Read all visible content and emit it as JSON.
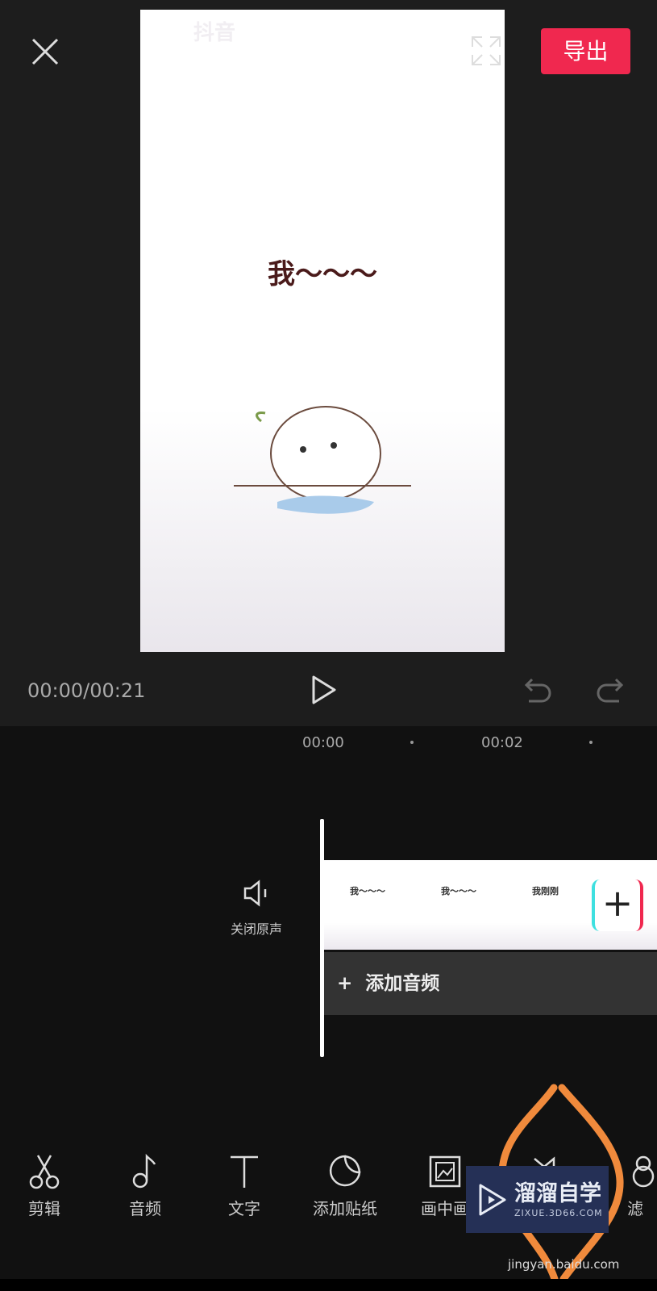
{
  "header": {
    "close_icon": "close-icon",
    "export_label": "导出",
    "fullscreen_icon": "fullscreen-icon"
  },
  "preview": {
    "watermark": "抖音",
    "caption": "我～～～"
  },
  "player": {
    "timecode": "00:00/00:21",
    "play_icon": "play-icon",
    "undo_icon": "undo-icon",
    "redo_icon": "redo-icon"
  },
  "timeline": {
    "ruler": [
      "00:00",
      "00:02"
    ],
    "mute_label": "关闭原声",
    "frames": [
      "我～～～",
      "我～～～",
      "我刚刚"
    ],
    "add_audio_label": "添加音频"
  },
  "toolbar": {
    "items": [
      {
        "label": "剪辑",
        "icon": "scissors-icon"
      },
      {
        "label": "音频",
        "icon": "music-note-icon"
      },
      {
        "label": "文字",
        "icon": "text-icon"
      },
      {
        "label": "添加贴纸",
        "icon": "sticker-icon"
      },
      {
        "label": "画中画",
        "icon": "picture-in-picture-icon"
      },
      {
        "label": "",
        "icon": "effects-icon"
      },
      {
        "label": "滤",
        "icon": "filter-icon"
      }
    ]
  },
  "overlay": {
    "brand": "溜溜自学",
    "brand_sub": "ZIXUE.3D66.COM",
    "site": "jingyan.baidu.com",
    "highlight_color": "#f08a3c"
  }
}
